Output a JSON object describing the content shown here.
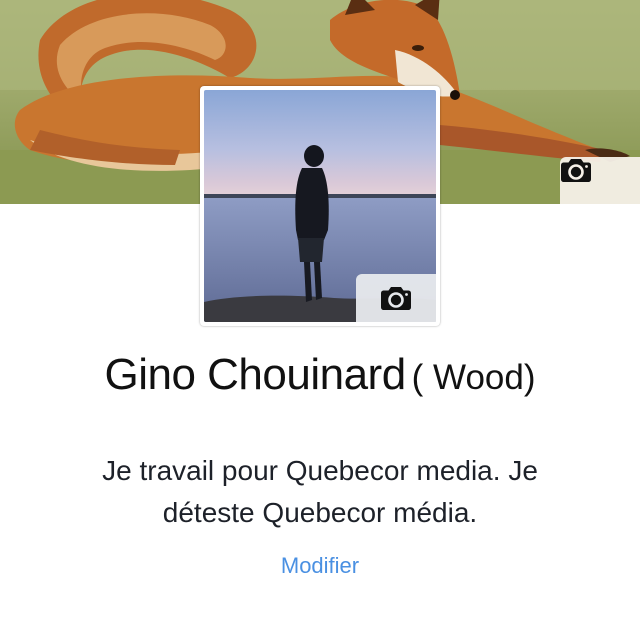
{
  "profile": {
    "name": "Gino Chouinard",
    "alternate_name": "( Wood)",
    "bio": "Je travail pour Quebecor media. Je déteste Quebecor média.",
    "edit_label": "Modifier"
  },
  "icons": {
    "cover_camera": "camera-icon",
    "profile_camera": "camera-icon"
  },
  "colors": {
    "link": "#4a90e2",
    "text": "#1d2129",
    "name": "#111111"
  }
}
